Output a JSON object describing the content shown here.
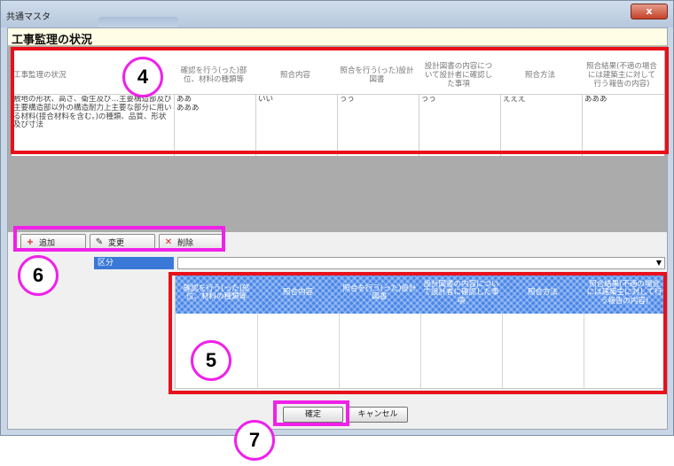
{
  "window": {
    "title": "共通マスタ",
    "close_glyph": "x"
  },
  "header": {
    "title": "工事監理の状況"
  },
  "grid": {
    "columns": [
      "工事監理の状況",
      "確認を行う(った)部位、材料の種類等",
      "照合内容",
      "照合を行う(った)設計図書",
      "設計図書の内容について設計者に確認した事項",
      "照合方法",
      "照合結果(不適の場合には建築主に対して行う報告の内容)"
    ],
    "rows": [
      [
        "敷地の形状、高さ、衛生及び…主要構造部及び主要構造部以外の構造耐力上主要な部分に用いる材料(接合材料を含む。)の種類、品質、形状及び寸法",
        "ああ",
        "いい",
        "うう",
        "うう",
        "えええ",
        "あああ"
      ],
      [
        "",
        "あああ",
        "",
        "",
        "",
        "",
        ""
      ]
    ]
  },
  "toolbar": {
    "add_label": "追加",
    "edit_label": "変更",
    "delete_label": "削除",
    "add_icon": "plus-icon",
    "edit_icon": "edit-icon",
    "delete_icon": "delete-icon"
  },
  "filter": {
    "label": "区分",
    "value": ""
  },
  "grid2": {
    "columns": [
      "確認を行う(った)部位、材料の種類等",
      "照合内容",
      "照合を行う(った)設計図書",
      "設計図書の内容について設計者に確認した事項",
      "照合方法",
      "照合結果(不適の場合には建築主に対して行う報告の内容)"
    ]
  },
  "footer": {
    "ok_label": "確定",
    "cancel_label": "キャンセル"
  },
  "markers": {
    "m4": "4",
    "m5": "5",
    "m6": "6",
    "m7": "7"
  },
  "colors": {
    "annotation_red": "#e8101a",
    "annotation_magenta": "#f021e8",
    "header_blue": "#4a86e8",
    "selected_label": "#3a78d8"
  }
}
